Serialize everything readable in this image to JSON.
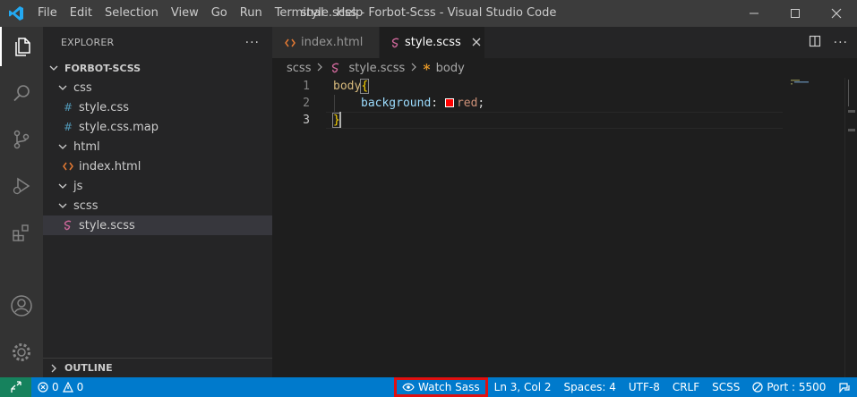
{
  "titlebar": {
    "menu": [
      "File",
      "Edit",
      "Selection",
      "View",
      "Go",
      "Run",
      "Terminal",
      "Help"
    ],
    "window_title": "style.scss - Forbot-Scss - Visual Studio Code"
  },
  "sidebar": {
    "header": "EXPLORER",
    "more": "···",
    "root": "FORBOT-SCSS",
    "tree": [
      {
        "label": "css",
        "kind": "folder",
        "depth": 1
      },
      {
        "label": "style.css",
        "kind": "css",
        "depth": 2
      },
      {
        "label": "style.css.map",
        "kind": "css",
        "depth": 2
      },
      {
        "label": "html",
        "kind": "folder",
        "depth": 1
      },
      {
        "label": "index.html",
        "kind": "html",
        "depth": 2
      },
      {
        "label": "js",
        "kind": "folder",
        "depth": 1
      },
      {
        "label": "scss",
        "kind": "folder",
        "depth": 1
      },
      {
        "label": "style.scss",
        "kind": "scss",
        "depth": 2
      }
    ],
    "outline": "OUTLINE"
  },
  "editor": {
    "tabs": [
      {
        "label": "index.html",
        "icon": "html-icon",
        "active": false
      },
      {
        "label": "style.scss",
        "icon": "sass-icon",
        "active": true
      }
    ],
    "breadcrumb": {
      "folder": "scss",
      "file": "style.scss",
      "symbol": "body"
    },
    "lines": {
      "n1": "1",
      "n2": "2",
      "n3": "3",
      "selector": "body",
      "open_brace": "{",
      "property": "background",
      "colon": ":",
      "value": "red",
      "semicolon": ";",
      "close_brace": "}"
    }
  },
  "statusbar": {
    "errors": "0",
    "warnings": "0",
    "watch_sass": "Watch Sass",
    "position": "Ln 3, Col 2",
    "spaces": "Spaces: 4",
    "encoding": "UTF-8",
    "eol": "CRLF",
    "language": "SCSS",
    "port": "Port : 5500"
  },
  "colors": {
    "accent": "#007acc",
    "remote": "#16825d",
    "highlight_box": "#e01010",
    "swatch": "#ff0000"
  }
}
